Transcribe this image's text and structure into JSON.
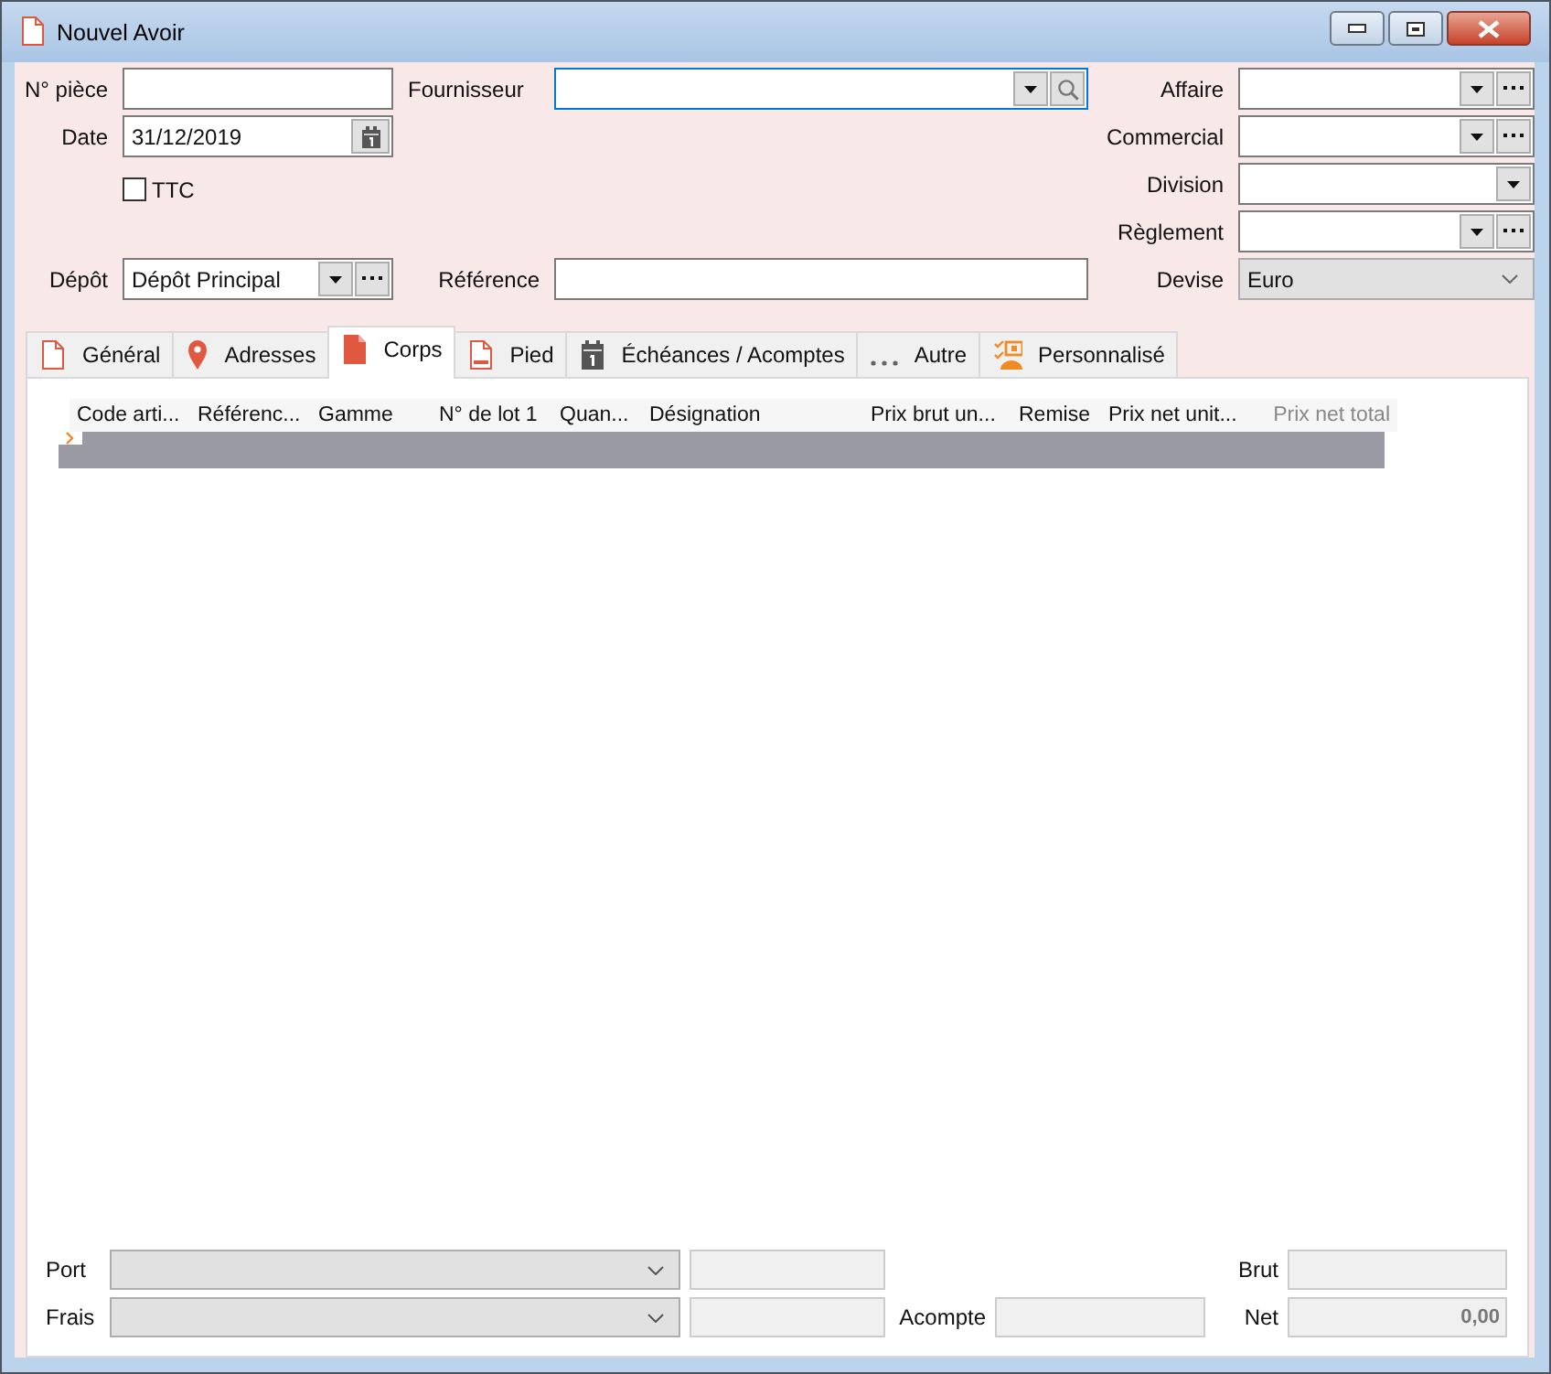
{
  "window": {
    "title": "Nouvel Avoir"
  },
  "left_fields": {
    "piece": {
      "label": "N° pièce"
    },
    "date": {
      "label": "Date",
      "value": "31/12/2019"
    },
    "ttc": {
      "label": "TTC",
      "checked": false
    },
    "depot": {
      "label": "Dépôt",
      "value": "Dépôt Principal"
    }
  },
  "middle_fields": {
    "fournisseur": {
      "label": "Fournisseur",
      "focused": true
    },
    "reference": {
      "label": "Référence"
    }
  },
  "right_fields": [
    {
      "label": "Affaire",
      "kind": "combo_more"
    },
    {
      "label": "Commercial",
      "kind": "combo_more"
    },
    {
      "label": "Division",
      "kind": "combo"
    },
    {
      "label": "Règlement",
      "kind": "combo_more"
    },
    {
      "label": "Devise",
      "kind": "select",
      "value": "Euro"
    }
  ],
  "tabs": [
    {
      "label": "Général",
      "kind": "doc",
      "selected": false
    },
    {
      "label": "Adresses",
      "kind": "pin",
      "selected": false
    },
    {
      "label": "Corps",
      "kind": "doc_filled",
      "selected": true
    },
    {
      "label": "Pied",
      "kind": "doc_footer",
      "selected": false
    },
    {
      "label": "Échéances / Acomptes",
      "kind": "calendar",
      "selected": false
    },
    {
      "label": "Autre",
      "kind": "dots",
      "selected": false
    },
    {
      "label": "Personnalisé",
      "kind": "custom",
      "selected": false
    }
  ],
  "table": {
    "columns": [
      {
        "label": "Code arti...",
        "disabled": false
      },
      {
        "label": "Référenc...",
        "disabled": false
      },
      {
        "label": "Gamme",
        "disabled": false
      },
      {
        "label": "N° de lot 1",
        "disabled": false
      },
      {
        "label": "Quan...",
        "disabled": false
      },
      {
        "label": "Désignation",
        "disabled": false
      },
      {
        "label": "Prix brut un...",
        "disabled": false
      },
      {
        "label": "Remise",
        "disabled": false
      },
      {
        "label": "Prix net unit...",
        "disabled": false
      },
      {
        "label": "Prix net total",
        "disabled": true
      }
    ],
    "rows": [
      {
        "selected": true
      }
    ]
  },
  "totals": {
    "port": {
      "label": "Port"
    },
    "frais": {
      "label": "Frais"
    },
    "acompte": {
      "label": "Acompte"
    },
    "brut": {
      "label": "Brut"
    },
    "net": {
      "label": "Net",
      "value": "0,00"
    }
  }
}
